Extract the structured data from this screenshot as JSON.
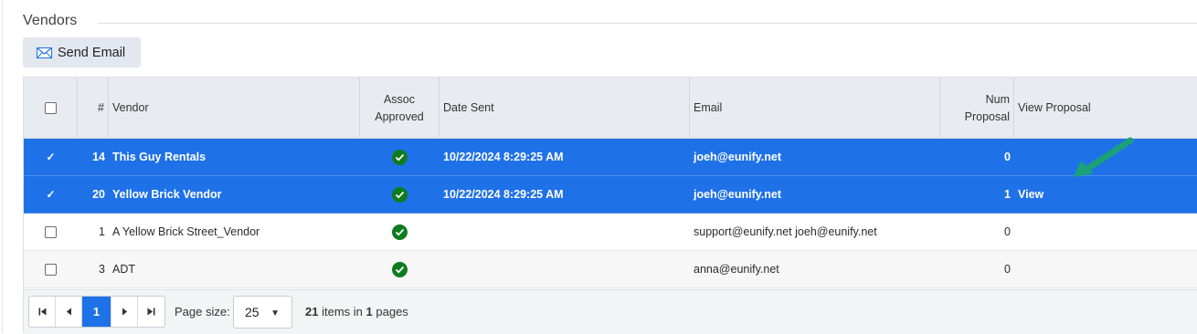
{
  "section": {
    "title": "Vendors"
  },
  "toolbar": {
    "send_email_label": "Send Email"
  },
  "grid": {
    "headers": {
      "num": "#",
      "vendor": "Vendor",
      "assoc_line1": "Assoc",
      "assoc_line2": "Approved",
      "date_sent": "Date Sent",
      "email": "Email",
      "num_proposal_line1": "Num",
      "num_proposal_line2": "Proposal",
      "view_proposal": "View Proposal"
    },
    "rows": [
      {
        "selected": true,
        "num": "14",
        "vendor": "This Guy Rentals",
        "assoc_approved": true,
        "date_sent": "10/22/2024 8:29:25 AM",
        "email": "joeh@eunify.net",
        "num_proposal": "0",
        "view": ""
      },
      {
        "selected": true,
        "num": "20",
        "vendor": "Yellow Brick Vendor",
        "assoc_approved": true,
        "date_sent": "10/22/2024 8:29:25 AM",
        "email": "joeh@eunify.net",
        "num_proposal": "1",
        "view": "View"
      },
      {
        "selected": false,
        "num": "1",
        "vendor": "A Yellow Brick Street_Vendor",
        "assoc_approved": true,
        "date_sent": "",
        "email": "support@eunify.net joeh@eunify.net",
        "num_proposal": "0",
        "view": ""
      },
      {
        "selected": false,
        "num": "3",
        "vendor": "ADT",
        "assoc_approved": true,
        "date_sent": "",
        "email": "anna@eunify.net",
        "num_proposal": "0",
        "view": ""
      }
    ]
  },
  "pager": {
    "current_page": "1",
    "page_size_label": "Page size:",
    "page_size": "25",
    "total_items": "21",
    "items_in_text": "items in",
    "total_pages": "1",
    "pages_text": "pages"
  },
  "colors": {
    "selected_row": "#1f71e8",
    "approved_icon": "#0f7b1e",
    "annotation_arrow": "#1aa17a"
  }
}
